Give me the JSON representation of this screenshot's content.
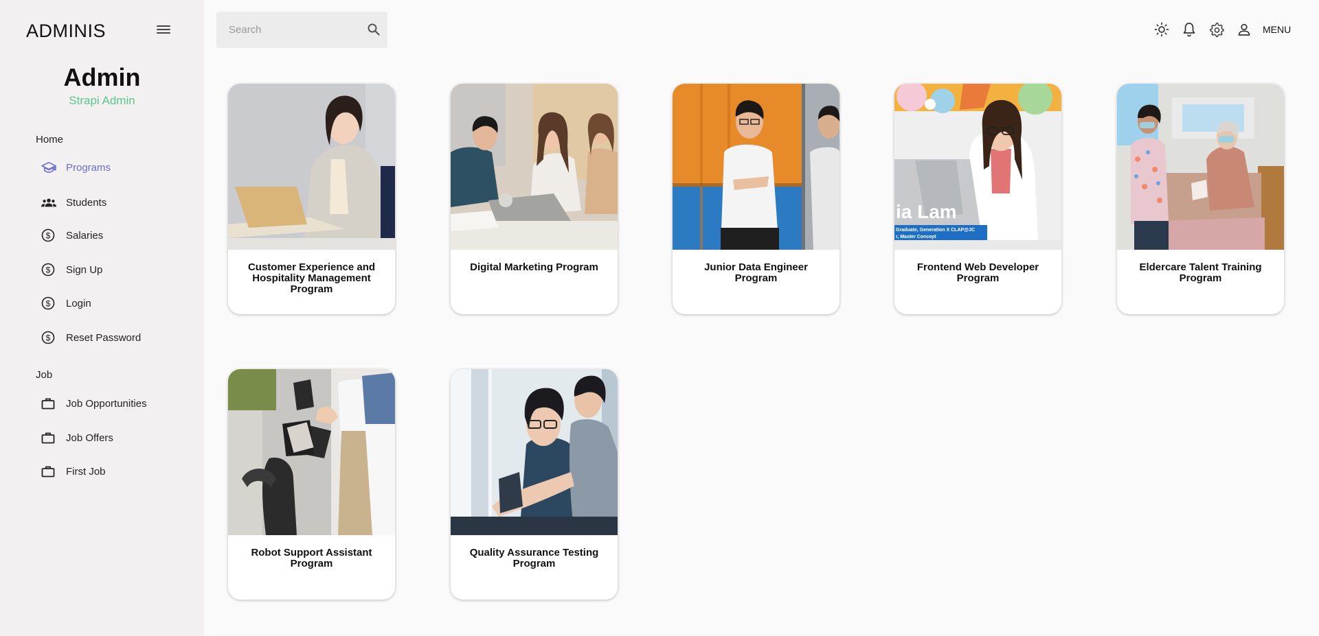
{
  "sidebar": {
    "brand": "ADMINIS",
    "profile": {
      "name": "Admin",
      "role": "Strapi Admin"
    },
    "sections": [
      {
        "title": "Home",
        "items": [
          {
            "label": "Programs",
            "icon": "graduation-cap-icon",
            "active": true
          },
          {
            "label": "Students",
            "icon": "people-icon"
          },
          {
            "label": "Salaries",
            "icon": "dollar-circle-icon"
          },
          {
            "label": "Sign Up",
            "icon": "dollar-circle-icon"
          },
          {
            "label": "Login",
            "icon": "dollar-circle-icon"
          },
          {
            "label": "Reset Password",
            "icon": "dollar-circle-icon"
          }
        ]
      },
      {
        "title": "Job",
        "items": [
          {
            "label": "Job Opportunities",
            "icon": "briefcase-icon"
          },
          {
            "label": "Job Offers",
            "icon": "briefcase-icon"
          },
          {
            "label": "First Job",
            "icon": "briefcase-icon"
          }
        ]
      }
    ]
  },
  "topbar": {
    "search_placeholder": "Search",
    "menu_label": "MENU",
    "icons": [
      "sun-icon",
      "bell-icon",
      "gear-icon",
      "user-icon"
    ]
  },
  "programs": [
    {
      "title": "Customer Experience and Hospitality Management Program"
    },
    {
      "title": "Digital Marketing Program"
    },
    {
      "title": "Junior Data Engineer Program"
    },
    {
      "title": "Frontend Web Developer Program",
      "image_overlay": {
        "name": "ia Lam",
        "line1": "Graduate, Generation X CLAP@JC",
        "line2": "r, Master Concept"
      }
    },
    {
      "title": "Eldercare Talent Training Program"
    },
    {
      "title": "Robot Support Assistant Program"
    },
    {
      "title": "Quality Assurance Testing Program"
    }
  ],
  "colors": {
    "accent": "#6b6fd1",
    "role": "#5cc48e",
    "sidebar_bg": "#f2f0f0"
  }
}
